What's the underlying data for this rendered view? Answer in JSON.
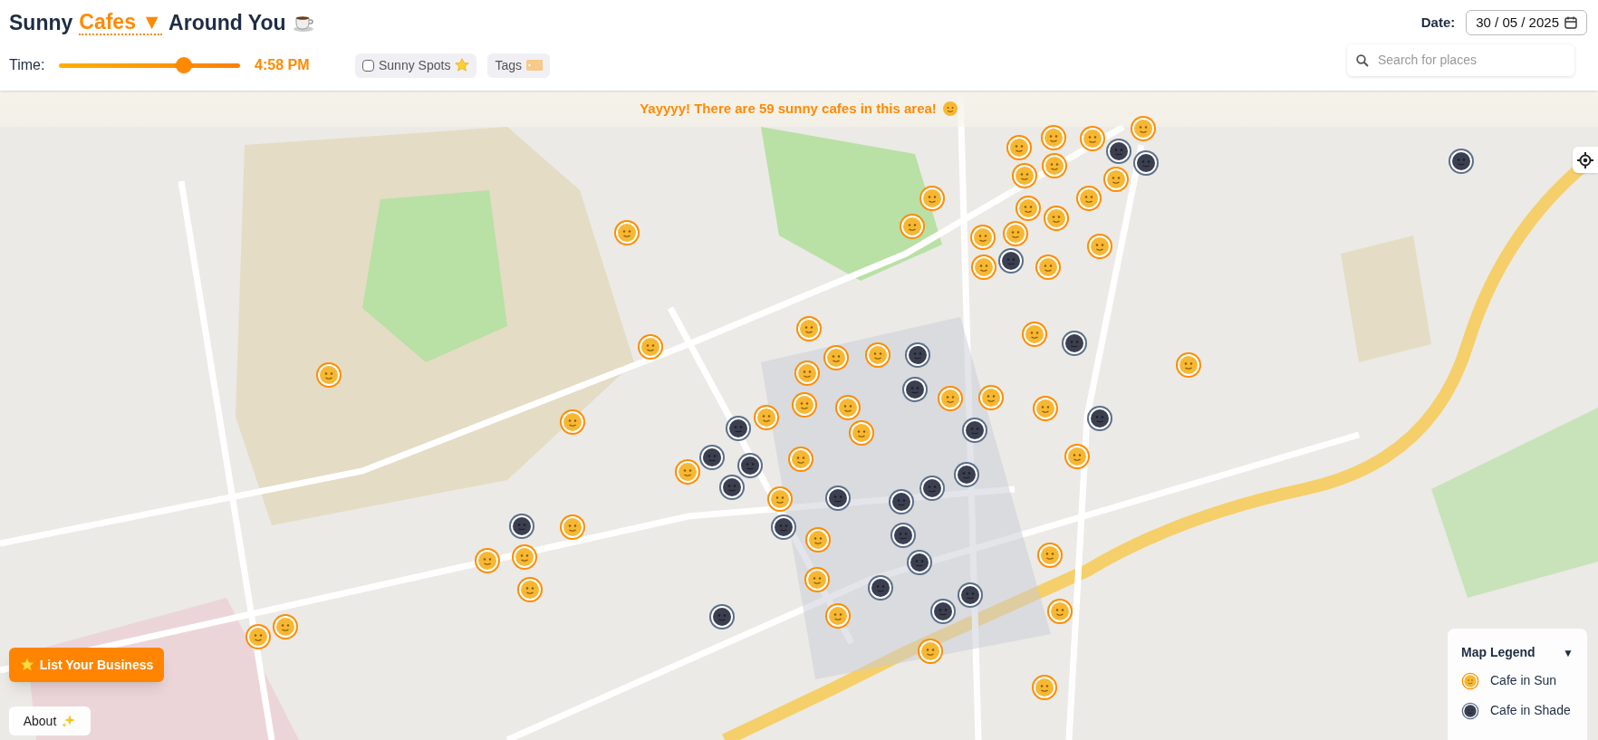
{
  "header": {
    "title_before": "Sunny",
    "title_dropdown": "Cafes ▼",
    "title_after": "Around You",
    "time_label": "Time:",
    "time_slider": {
      "level": 0.69
    },
    "time_value": "4:58 PM",
    "sunny_spots": {
      "label": "Sunny Spots",
      "checked": false
    },
    "tags_button": "Tags",
    "date_label": "Date:",
    "date_value": "30 / 05 / 2025",
    "search": {
      "placeholder": "Search for places"
    }
  },
  "banner": "Yayyyy! There are 59 sunny cafes in this area!",
  "markers": [
    {
      "kind": "sun"
    },
    {
      "kind": "sun"
    },
    {
      "kind": "sun"
    },
    {
      "kind": "sun"
    },
    {
      "kind": "sun"
    },
    {
      "kind": "sun"
    },
    {
      "kind": "sun"
    },
    {
      "kind": "sun"
    },
    {
      "kind": "sun"
    },
    {
      "kind": "sun"
    },
    {
      "kind": "sun"
    },
    {
      "kind": "sun"
    },
    {
      "kind": "sun"
    },
    {
      "kind": "sun"
    },
    {
      "kind": "sun"
    },
    {
      "kind": "sun"
    },
    {
      "kind": "sun"
    },
    {
      "kind": "sun"
    },
    {
      "kind": "sun"
    },
    {
      "kind": "sun"
    },
    {
      "kind": "sun"
    },
    {
      "kind": "sun"
    },
    {
      "kind": "sun"
    },
    {
      "kind": "sun"
    },
    {
      "kind": "sun"
    },
    {
      "kind": "sun"
    },
    {
      "kind": "sun"
    },
    {
      "kind": "sun"
    },
    {
      "kind": "sun"
    },
    {
      "kind": "sun"
    },
    {
      "kind": "sun"
    },
    {
      "kind": "sun"
    },
    {
      "kind": "sun"
    },
    {
      "kind": "sun"
    },
    {
      "kind": "sun"
    },
    {
      "kind": "sun"
    },
    {
      "kind": "sun"
    },
    {
      "kind": "sun"
    },
    {
      "kind": "sun"
    },
    {
      "kind": "sun"
    },
    {
      "kind": "sun"
    },
    {
      "kind": "sun"
    },
    {
      "kind": "sun"
    },
    {
      "kind": "sun"
    },
    {
      "kind": "sun"
    },
    {
      "kind": "sun"
    },
    {
      "kind": "sun"
    },
    {
      "kind": "sun"
    },
    {
      "kind": "sun"
    },
    {
      "kind": "sun"
    },
    {
      "kind": "sun"
    },
    {
      "kind": "shade"
    },
    {
      "kind": "shade"
    },
    {
      "kind": "shade"
    },
    {
      "kind": "shade"
    },
    {
      "kind": "shade"
    },
    {
      "kind": "shade"
    },
    {
      "kind": "shade"
    },
    {
      "kind": "shade"
    },
    {
      "kind": "shade"
    },
    {
      "kind": "shade"
    },
    {
      "kind": "shade"
    },
    {
      "kind": "shade"
    },
    {
      "kind": "shade"
    },
    {
      "kind": "shade"
    },
    {
      "kind": "shade"
    },
    {
      "kind": "shade"
    },
    {
      "kind": "shade"
    },
    {
      "kind": "shade"
    },
    {
      "kind": "shade"
    },
    {
      "kind": "shade"
    },
    {
      "kind": "shade"
    },
    {
      "kind": "shade"
    },
    {
      "kind": "shade"
    },
    {
      "kind": "shade"
    },
    {
      "kind": "shade"
    }
  ],
  "legend": {
    "title": "Map Legend",
    "toggle": "▼",
    "items": [
      {
        "kind": "sun",
        "label": "Cafe in Sun"
      },
      {
        "kind": "shade",
        "label": "Cafe in Shade"
      }
    ]
  },
  "list_business_button": "List Your Business",
  "about_button": "About"
}
